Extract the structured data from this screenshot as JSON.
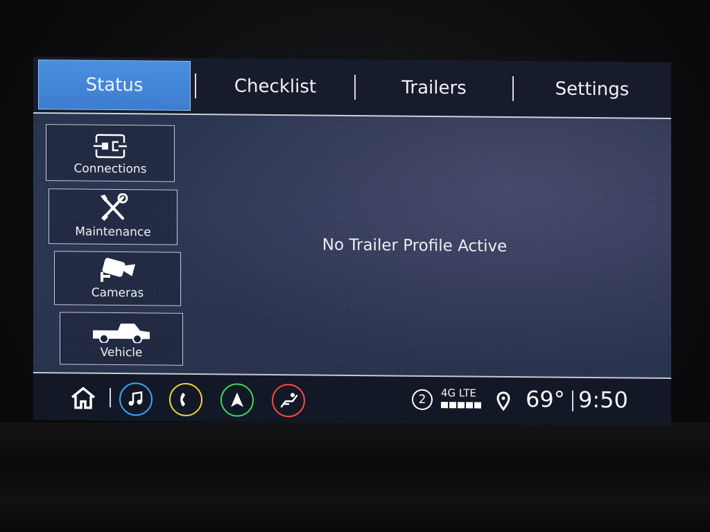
{
  "tabs": [
    {
      "label": "Status",
      "active": true
    },
    {
      "label": "Checklist",
      "active": false
    },
    {
      "label": "Trailers",
      "active": false
    },
    {
      "label": "Settings",
      "active": false
    }
  ],
  "side_menu": [
    {
      "label": "Connections",
      "icon": "connections-icon"
    },
    {
      "label": "Maintenance",
      "icon": "wrench-screwdriver-icon"
    },
    {
      "label": "Cameras",
      "icon": "camera-icon"
    },
    {
      "label": "Vehicle",
      "icon": "pickup-truck-icon"
    }
  ],
  "main": {
    "message": "No Trailer Profile Active"
  },
  "bottom_bar": {
    "apps": [
      {
        "name": "home",
        "icon": "home-icon"
      },
      {
        "name": "audio",
        "icon": "music-note-icon",
        "color": "#3aa7ff"
      },
      {
        "name": "phone",
        "icon": "phone-icon",
        "color": "#f3d23a"
      },
      {
        "name": "nav",
        "icon": "navigation-arrow-icon",
        "color": "#3fd45c"
      },
      {
        "name": "vehicle-seat",
        "icon": "seat-icon",
        "color": "#ff4a3a"
      }
    ],
    "notification_count": "2",
    "network": "4G LTE",
    "temperature": "69°",
    "time": "9:50"
  }
}
